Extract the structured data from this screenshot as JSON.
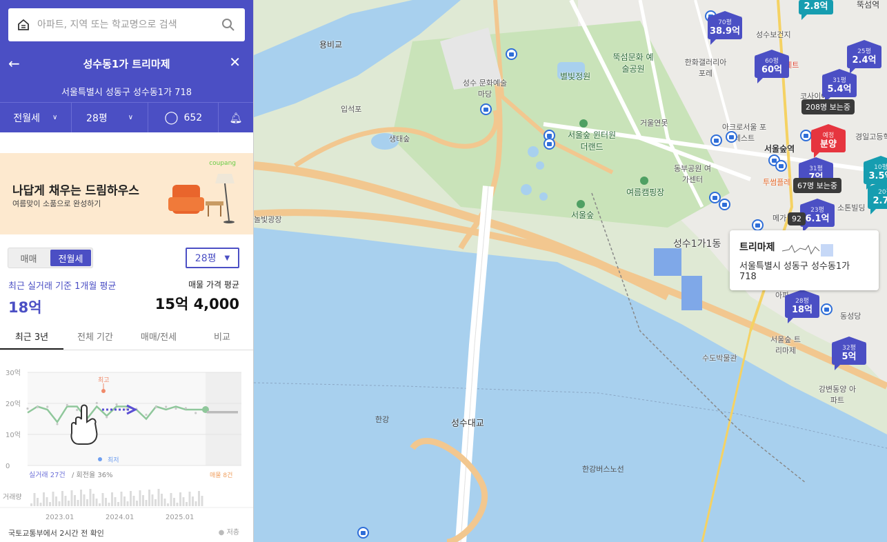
{
  "search": {
    "placeholder": "아파트, 지역 또는 학교명으로 검색"
  },
  "header": {
    "title": "성수동1가 트리마제",
    "address": "서울특별시 성동구 성수동1가 718"
  },
  "tabs": {
    "deal_type": "전월세",
    "size": "28평",
    "comments": "652"
  },
  "ad": {
    "brand": "coupang",
    "headline": "나답게 채우는 드림하우스",
    "sub": "여름맞이 소품으로 완성하기"
  },
  "segment": {
    "sale": "매매",
    "rent": "전월세",
    "size_select": "28평"
  },
  "stats": {
    "recent_label": "최근 실거래 기준 1개월 평균",
    "recent_value": "18억",
    "listing_label": "매물 가격 평균",
    "listing_value": "15억 4,000"
  },
  "chart_tabs": [
    "최근 3년",
    "전체 기간",
    "매매/전세",
    "비교"
  ],
  "chart": {
    "max_label": "최고",
    "min_label": "최저",
    "deals": "실거래 27건",
    "turnover": "/ 회전율 36%",
    "listings": "매물 8건",
    "volume_label": "거래량",
    "source": "국토교통부에서 2시간 전 확인",
    "legend": "저층"
  },
  "chart_data": {
    "type": "line",
    "x": [
      "2023.01",
      "2024.01",
      "2025.01"
    ],
    "y_ticks": [
      "30억",
      "20억",
      "10억",
      "0"
    ],
    "ylim": [
      0,
      30
    ],
    "series": [
      {
        "values": [
          17,
          19,
          18,
          14,
          19,
          19,
          15,
          19,
          16,
          19,
          19,
          18,
          15,
          19,
          18,
          19,
          18,
          18,
          18
        ]
      }
    ]
  },
  "map": {
    "labels": [
      "용비교",
      "성수 문화예술마당",
      "뚝섬문화 예술공원",
      "별빛정원",
      "한화갤러리아 포레",
      "성수보건지",
      "입석포",
      "생태숲",
      "서울숲 윈터원더랜드",
      "거울연못",
      "아크로서울 포레스트",
      "서울숲역",
      "동부공원 여가센터",
      "여름캠핑장",
      "서울숲",
      "놀빛광장",
      "성수1가1동",
      "수도박물관",
      "서울숲 트리마제",
      "강변동양 아파트",
      "동성당",
      "한강",
      "성수대교",
      "한강버스노선",
      "뚝섬역",
      "경일고등학교",
      "투썸플레",
      "소톤빌딩",
      "메가",
      "코사이어",
      "파케트",
      "아파"
    ],
    "markers": [
      {
        "py": "70평",
        "pr": "38.9억"
      },
      {
        "py": "60평",
        "pr": "60억"
      },
      {
        "py": "25평",
        "pr": "2.4억"
      },
      {
        "py": "31평",
        "pr": "5.4억"
      },
      {
        "py": "31평",
        "pr": "7억"
      },
      {
        "py": "23평",
        "pr": "6.1억"
      },
      {
        "py": "28평",
        "pr": "18억"
      },
      {
        "py": "32평",
        "pr": "5억"
      },
      {
        "py": "10평",
        "pr": "3.5억"
      },
      {
        "py": "20평",
        "pr": "2.7억"
      },
      {
        "py": "",
        "pr": "2.8억"
      },
      {
        "py": "예정",
        "pr": "분양"
      }
    ],
    "badges": [
      "208명 보는중",
      "67명 보는중",
      "92"
    ],
    "popup": {
      "title": "트리마제",
      "address": "서울특별시 성동구 성수동1가 718"
    }
  }
}
